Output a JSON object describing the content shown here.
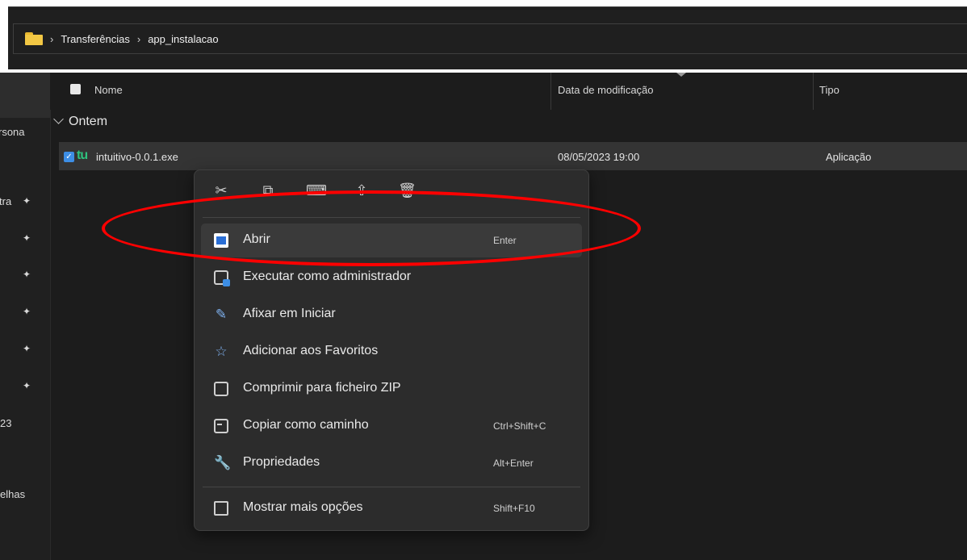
{
  "breadcrumb": [
    "Transferências",
    "app_instalacao"
  ],
  "nav": {
    "items": [
      "rsona",
      "tra",
      "23",
      "elhas"
    ]
  },
  "columns": {
    "name": "Nome",
    "date": "Data de modificação",
    "type": "Tipo"
  },
  "group_label": "Ontem",
  "file": {
    "icon_text": "tu",
    "name": "intuitivo-0.0.1.exe",
    "date": "08/05/2023 19:00",
    "type": "Aplicação"
  },
  "quick_actions": [
    {
      "icon": "cut-icon",
      "glyph": "✂"
    },
    {
      "icon": "copy-icon",
      "glyph": "⧉"
    },
    {
      "icon": "rename-icon",
      "glyph": "⌨"
    },
    {
      "icon": "share-icon",
      "glyph": "⇪"
    },
    {
      "icon": "delete-icon",
      "glyph": "🗑"
    }
  ],
  "menu_items": [
    {
      "label": "Abrir",
      "shortcut": "Enter",
      "icon": "open-icon"
    },
    {
      "label": "Executar como administrador",
      "shortcut": "",
      "icon": "admin-icon"
    },
    {
      "label": "Afixar em Iniciar",
      "shortcut": "",
      "icon": "pin-icon"
    },
    {
      "label": "Adicionar aos Favoritos",
      "shortcut": "",
      "icon": "star-icon"
    },
    {
      "label": "Comprimir para ficheiro ZIP",
      "shortcut": "",
      "icon": "zip-icon"
    },
    {
      "label": "Copiar como caminho",
      "shortcut": "Ctrl+Shift+C",
      "icon": "path-icon"
    },
    {
      "label": "Propriedades",
      "shortcut": "Alt+Enter",
      "icon": "wrench-icon"
    },
    {
      "label": "Mostrar mais opções",
      "shortcut": "Shift+F10",
      "icon": "more-options-icon"
    }
  ],
  "annotation_color": "#ff0000"
}
